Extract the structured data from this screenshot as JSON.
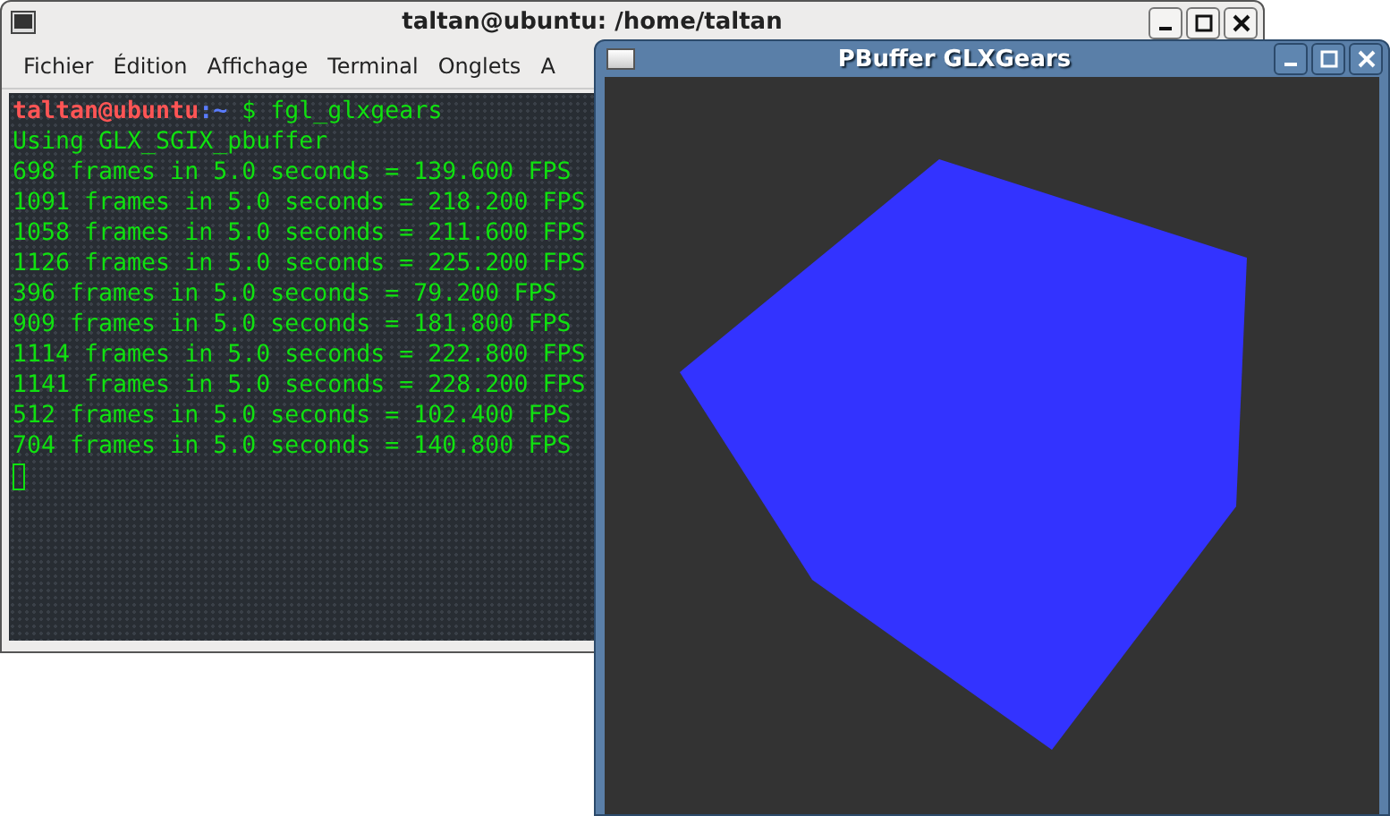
{
  "terminal_window": {
    "title": "taltan@ubuntu: /home/taltan",
    "menu": [
      "Fichier",
      "Édition",
      "Affichage",
      "Terminal",
      "Onglets",
      "A"
    ],
    "prompt": {
      "user_host": "taltan@ubuntu",
      "separator": ":",
      "path": "~",
      "command": "$ fgl_glxgears"
    },
    "output_lines": [
      "Using GLX_SGIX_pbuffer",
      "698 frames in 5.0 seconds = 139.600 FPS",
      "1091 frames in 5.0 seconds = 218.200 FPS",
      "1058 frames in 5.0 seconds = 211.600 FPS",
      "1126 frames in 5.0 seconds = 225.200 FPS",
      "396 frames in 5.0 seconds = 79.200 FPS",
      "909 frames in 5.0 seconds = 181.800 FPS",
      "1114 frames in 5.0 seconds = 222.800 FPS",
      "1141 frames in 5.0 seconds = 228.200 FPS",
      "512 frames in 5.0 seconds = 102.400 FPS",
      "704 frames in 5.0 seconds = 140.800 FPS"
    ]
  },
  "glx_window": {
    "title": "PBuffer GLXGears"
  }
}
